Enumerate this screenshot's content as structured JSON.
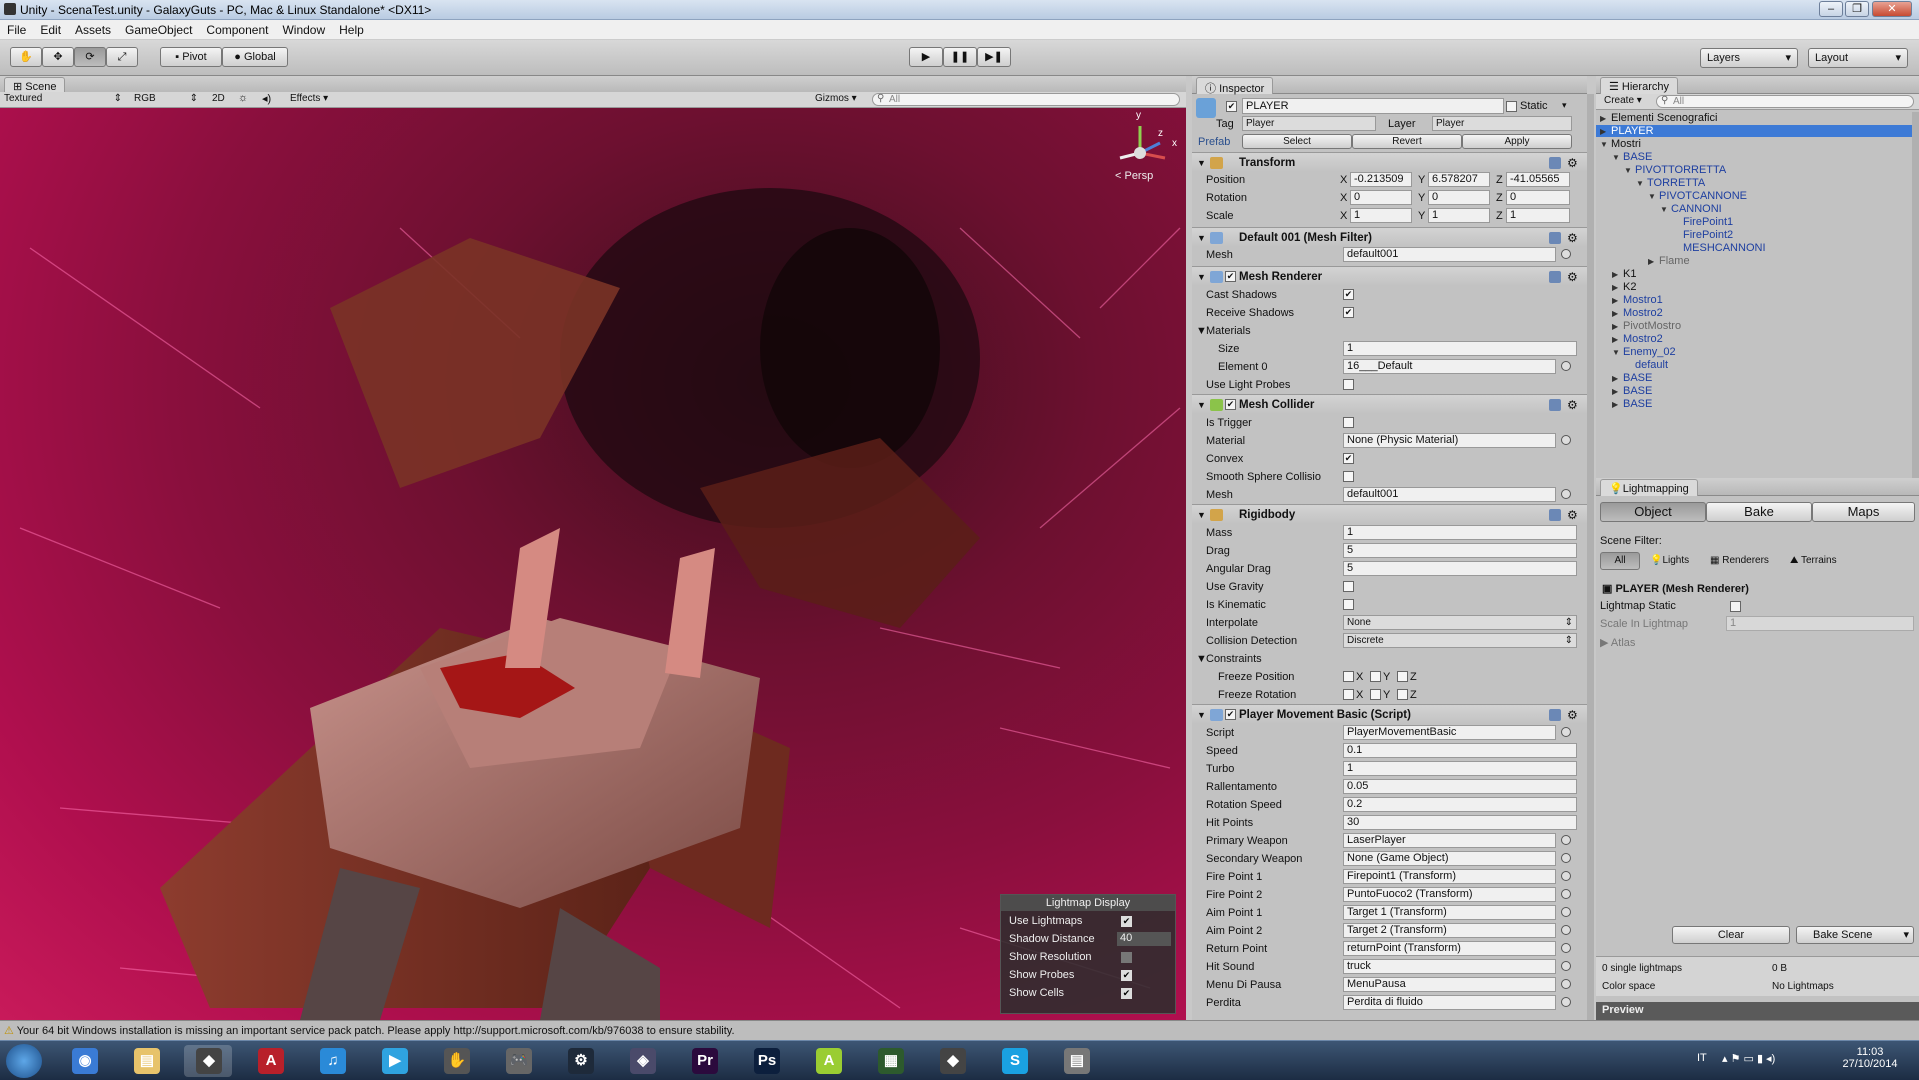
{
  "window": {
    "title": "Unity - ScenaTest.unity - GalaxyGuts - PC, Mac & Linux Standalone* <DX11>"
  },
  "menu": [
    "File",
    "Edit",
    "Assets",
    "GameObject",
    "Component",
    "Window",
    "Help"
  ],
  "toolbar": {
    "pivot": "Pivot",
    "global": "Global",
    "layers": "Layers",
    "layout": "Layout"
  },
  "scene": {
    "tab": "Scene",
    "shading": "Textured",
    "render_mode": "RGB",
    "mode_2d": "2D",
    "effects": "Effects",
    "gizmos": "Gizmos",
    "search_placeholder": "All",
    "persp": "< Persp",
    "axis_y": "y",
    "axis_z": "z",
    "axis_x": "x",
    "lightmap_display": {
      "title": "Lightmap Display",
      "use_lightmaps": "Use Lightmaps",
      "shadow_distance": "Shadow Distance",
      "shadow_distance_value": "40",
      "show_resolution": "Show Resolution",
      "show_probes": "Show Probes",
      "show_cells": "Show Cells"
    }
  },
  "inspector": {
    "tab": "Inspector",
    "object_name": "PLAYER",
    "static_label": "Static",
    "tag_label": "Tag",
    "tag_value": "Player",
    "layer_label": "Layer",
    "layer_value": "Player",
    "prefab_label": "Prefab",
    "prefab_select": "Select",
    "prefab_revert": "Revert",
    "prefab_apply": "Apply",
    "transform": {
      "title": "Transform",
      "position_label": "Position",
      "rotation_label": "Rotation",
      "scale_label": "Scale",
      "position": {
        "x": "-0.213509",
        "y": "6.578207",
        "z": "-41.05565"
      },
      "rotation": {
        "x": "0",
        "y": "0",
        "z": "0"
      },
      "scale": {
        "x": "1",
        "y": "1",
        "z": "1"
      },
      "x": "X",
      "y": "Y",
      "z": "Z"
    },
    "mesh_filter": {
      "title": "Default 001 (Mesh Filter)",
      "mesh_label": "Mesh",
      "mesh_value": "default001"
    },
    "mesh_renderer": {
      "title": "Mesh Renderer",
      "cast_shadows": "Cast Shadows",
      "receive_shadows": "Receive Shadows",
      "materials": "Materials",
      "size_label": "Size",
      "size_value": "1",
      "element0_label": "Element 0",
      "element0_value": "16___Default",
      "use_light_probes": "Use Light Probes"
    },
    "mesh_collider": {
      "title": "Mesh Collider",
      "is_trigger": "Is Trigger",
      "material_label": "Material",
      "material_value": "None (Physic Material)",
      "convex": "Convex",
      "smooth": "Smooth Sphere Collisio",
      "mesh_label": "Mesh",
      "mesh_value": "default001"
    },
    "rigidbody": {
      "title": "Rigidbody",
      "mass_label": "Mass",
      "mass": "1",
      "drag_label": "Drag",
      "drag": "5",
      "angular_drag_label": "Angular Drag",
      "angular_drag": "5",
      "use_gravity": "Use Gravity",
      "is_kinematic": "Is Kinematic",
      "interpolate_label": "Interpolate",
      "interpolate": "None",
      "collision_label": "Collision Detection",
      "collision": "Discrete",
      "constraints": "Constraints",
      "freeze_position": "Freeze Position",
      "freeze_rotation": "Freeze Rotation",
      "x": "X",
      "y": "Y",
      "z": "Z"
    },
    "script": {
      "title": "Player Movement Basic (Script)",
      "fields": [
        {
          "label": "Script",
          "value": "PlayerMovementBasic",
          "obj": true
        },
        {
          "label": "Speed",
          "value": "0.1"
        },
        {
          "label": "Turbo",
          "value": "1"
        },
        {
          "label": "Rallentamento",
          "value": "0.05"
        },
        {
          "label": "Rotation Speed",
          "value": "0.2"
        },
        {
          "label": "Hit Points",
          "value": "30"
        },
        {
          "label": "Primary Weapon",
          "value": "LaserPlayer",
          "obj": true
        },
        {
          "label": "Secondary Weapon",
          "value": "None (Game Object)",
          "obj": true
        },
        {
          "label": "Fire Point 1",
          "value": "Firepoint1 (Transform)",
          "obj": true
        },
        {
          "label": "Fire Point 2",
          "value": "PuntoFuoco2 (Transform)",
          "obj": true
        },
        {
          "label": "Aim Point 1",
          "value": "Target 1 (Transform)",
          "obj": true
        },
        {
          "label": "Aim Point 2",
          "value": "Target 2 (Transform)",
          "obj": true
        },
        {
          "label": "Return Point",
          "value": "returnPoint (Transform)",
          "obj": true
        },
        {
          "label": "Hit Sound",
          "value": "truck",
          "obj": true
        },
        {
          "label": "Menu Di Pausa",
          "value": "MenuPausa",
          "obj": true
        },
        {
          "label": "Perdita",
          "value": "Perdita di fluido",
          "obj": true
        }
      ]
    }
  },
  "hierarchy": {
    "tab": "Hierarchy",
    "create": "Create",
    "search_placeholder": "All",
    "items": [
      {
        "label": "Elementi Scenografici",
        "indent": 0,
        "arrow": "▶",
        "style": ""
      },
      {
        "label": "PLAYER",
        "indent": 0,
        "arrow": "▶",
        "style": "sel"
      },
      {
        "label": "Mostri",
        "indent": 0,
        "arrow": "▼",
        "style": ""
      },
      {
        "label": "BASE",
        "indent": 1,
        "arrow": "▼",
        "style": "blue"
      },
      {
        "label": "PIVOTTORRETTA",
        "indent": 2,
        "arrow": "▼",
        "style": "blue"
      },
      {
        "label": "TORRETTA",
        "indent": 3,
        "arrow": "▼",
        "style": "blue"
      },
      {
        "label": "PIVOTCANNONE",
        "indent": 4,
        "arrow": "▼",
        "style": "blue"
      },
      {
        "label": "CANNONI",
        "indent": 5,
        "arrow": "▼",
        "style": "blue"
      },
      {
        "label": "FirePoint1",
        "indent": 6,
        "arrow": "",
        "style": "blue"
      },
      {
        "label": "FirePoint2",
        "indent": 6,
        "arrow": "",
        "style": "blue"
      },
      {
        "label": "MESHCANNONI",
        "indent": 6,
        "arrow": "",
        "style": "blue"
      },
      {
        "label": "Flame",
        "indent": 4,
        "arrow": "▶",
        "style": "gray"
      },
      {
        "label": "K1",
        "indent": 1,
        "arrow": "▶",
        "style": ""
      },
      {
        "label": "K2",
        "indent": 1,
        "arrow": "▶",
        "style": ""
      },
      {
        "label": "Mostro1",
        "indent": 1,
        "arrow": "▶",
        "style": "blue"
      },
      {
        "label": "Mostro2",
        "indent": 1,
        "arrow": "▶",
        "style": "blue"
      },
      {
        "label": "PivotMostro",
        "indent": 1,
        "arrow": "▶",
        "style": "gray"
      },
      {
        "label": "Mostro2",
        "indent": 1,
        "arrow": "▶",
        "style": "blue"
      },
      {
        "label": "Enemy_02",
        "indent": 1,
        "arrow": "▼",
        "style": "blue"
      },
      {
        "label": "default",
        "indent": 2,
        "arrow": "",
        "style": "blue"
      },
      {
        "label": "BASE",
        "indent": 1,
        "arrow": "▶",
        "style": "blue"
      },
      {
        "label": "BASE",
        "indent": 1,
        "arrow": "▶",
        "style": "blue"
      },
      {
        "label": "BASE",
        "indent": 1,
        "arrow": "▶",
        "style": "blue"
      }
    ]
  },
  "lightmapping": {
    "tab": "Lightmapping",
    "tabs": [
      "Object",
      "Bake",
      "Maps"
    ],
    "scene_filter": "Scene Filter:",
    "filters": [
      "All",
      "Lights",
      "Renderers",
      "Terrains"
    ],
    "object_title": "PLAYER (Mesh Renderer)",
    "lightmap_static": "Lightmap Static",
    "scale_label": "Scale In Lightmap",
    "scale_value": "1",
    "atlas": "Atlas",
    "clear": "Clear",
    "bake_scene": "Bake Scene",
    "single_lightmaps": "0 single lightmaps",
    "size": "0 B",
    "color_space": "Color space",
    "no_lightmaps": "No Lightmaps",
    "preview": "Preview"
  },
  "status": {
    "warning": "Your 64 bit Windows installation is missing an important service pack patch. Please apply http://support.microsoft.com/kb/976038 to ensure stability."
  },
  "taskbar": {
    "lang": "IT",
    "time": "11:03",
    "date": "27/10/2014",
    "apps": [
      "chrome",
      "explorer",
      "unity",
      "acrobat",
      "itunes",
      "media",
      "tool",
      "gamepad",
      "steam",
      "app",
      "premiere",
      "photoshop",
      "android",
      "monitor",
      "unity-alt",
      "skype",
      "files"
    ]
  }
}
